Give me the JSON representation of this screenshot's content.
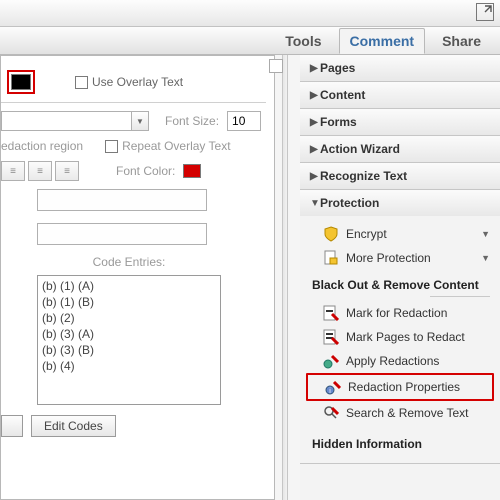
{
  "tabs": {
    "tools": "Tools",
    "comment": "Comment",
    "share": "Share"
  },
  "left": {
    "use_overlay": "Use Overlay Text",
    "font_size_label": "Font Size:",
    "font_size_value": "10",
    "redaction_region": "edaction region",
    "repeat_overlay": "Repeat Overlay Text",
    "font_color_label": "Font Color:",
    "code_entries_label": "Code Entries:",
    "codes": [
      "(b) (1) (A)",
      "(b) (1) (B)",
      "(b) (2)",
      "(b) (3) (A)",
      "(b) (3) (B)",
      "(b) (4)"
    ],
    "edit_codes": "Edit Codes"
  },
  "panels": {
    "pages": "Pages",
    "content": "Content",
    "forms": "Forms",
    "action_wizard": "Action Wizard",
    "recognize_text": "Recognize Text",
    "protection": "Protection",
    "hidden": "Hidden Information"
  },
  "protection": {
    "encrypt": "Encrypt",
    "more": "More Protection",
    "subhead": "Black Out & Remove Content",
    "mark": "Mark for Redaction",
    "mark_pages": "Mark Pages to Redact",
    "apply": "Apply Redactions",
    "properties": "Redaction Properties",
    "search": "Search & Remove Text"
  }
}
